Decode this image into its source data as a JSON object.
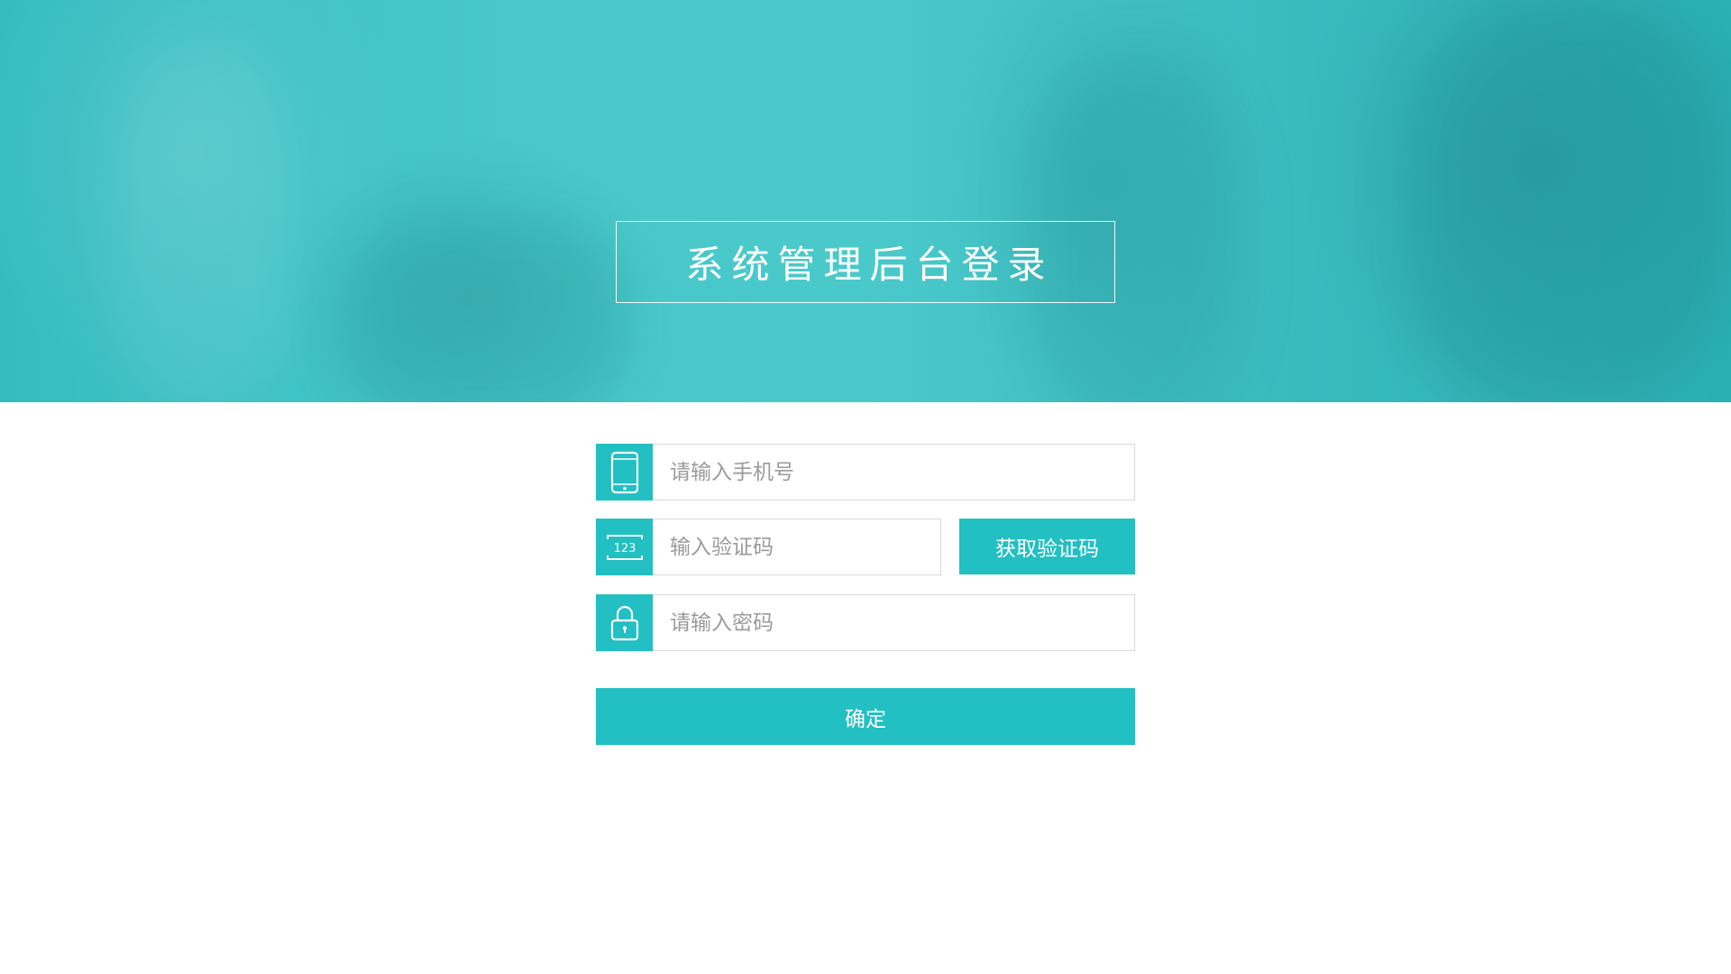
{
  "header": {
    "title": "系统管理后台登录"
  },
  "form": {
    "phone": {
      "icon": "mobile-phone-icon",
      "placeholder": "请输入手机号",
      "value": ""
    },
    "code": {
      "icon": "numeric-code-icon",
      "icon_text": "123",
      "placeholder": "输入验证码",
      "value": "",
      "button_label": "获取验证码"
    },
    "password": {
      "icon": "lock-icon",
      "placeholder": "请输入密码",
      "value": ""
    },
    "submit_label": "确定"
  },
  "colors": {
    "accent": "#22bfc3",
    "hero": "#48c8ca",
    "input_border": "#d9d9d9",
    "placeholder": "#9a9a9a"
  }
}
